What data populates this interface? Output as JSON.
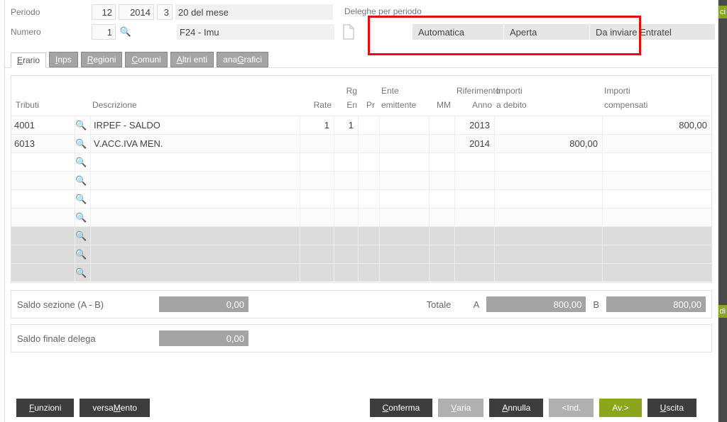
{
  "header": {
    "periodo_label": "Periodo",
    "numero_label": "Numero",
    "periodo_mese": "12",
    "periodo_anno": "2014",
    "periodo_n": "3",
    "periodo_desc": "20 del mese",
    "numero_val": "1",
    "numero_desc": "F24 - Imu",
    "deleghe_label": "Deleghe per periodo",
    "status": {
      "automatica": "Automatica",
      "aperta": "Aperta",
      "invio": "Da inviare Entratel"
    }
  },
  "tabs": {
    "erario": "Erario",
    "inps": "Inps",
    "regioni": "Regioni",
    "comuni": "Comuni",
    "altri": "Altri enti",
    "anagrafici": "anaGrafici"
  },
  "grid": {
    "hdr": {
      "tributi": "Tributi",
      "descrizione": "Descrizione",
      "rate": "Rate",
      "rg": "Rg",
      "en": "En",
      "pr": "Pr",
      "ente": "Ente",
      "emit": "emittente",
      "rif": "Riferimento",
      "mm": "MM",
      "anno": "Anno",
      "importi": "Importi",
      "adeb": "a debito",
      "comp": "compensati"
    },
    "rows": [
      {
        "tributo": "4001",
        "desc": "IRPEF - SALDO",
        "rate": "1",
        "rg": "1",
        "anno": "2013",
        "deb": "",
        "comp": "800,00"
      },
      {
        "tributo": "6013",
        "desc": "V.ACC.IVA MEN.",
        "rate": "",
        "rg": "",
        "anno": "2014",
        "deb": "800,00",
        "comp": ""
      }
    ]
  },
  "totals": {
    "saldo_sezione_lbl": "Saldo sezione (A - B)",
    "saldo_sezione_val": "0,00",
    "totale_lbl": "Totale",
    "a_lbl": "A",
    "a_val": "800,00",
    "b_lbl": "B",
    "b_val": "800,00",
    "saldo_finale_lbl": "Saldo finale delega",
    "saldo_finale_val": "0,00"
  },
  "footer": {
    "funzioni": "Funzioni",
    "versamento": "versaMento",
    "conferma": "Conferma",
    "varia": "Varia",
    "annulla": "Annulla",
    "ind": "<Ind.",
    "av": "Av.>",
    "uscita": "Uscita"
  },
  "side": {
    "top": "ci",
    "bottom": "di"
  }
}
